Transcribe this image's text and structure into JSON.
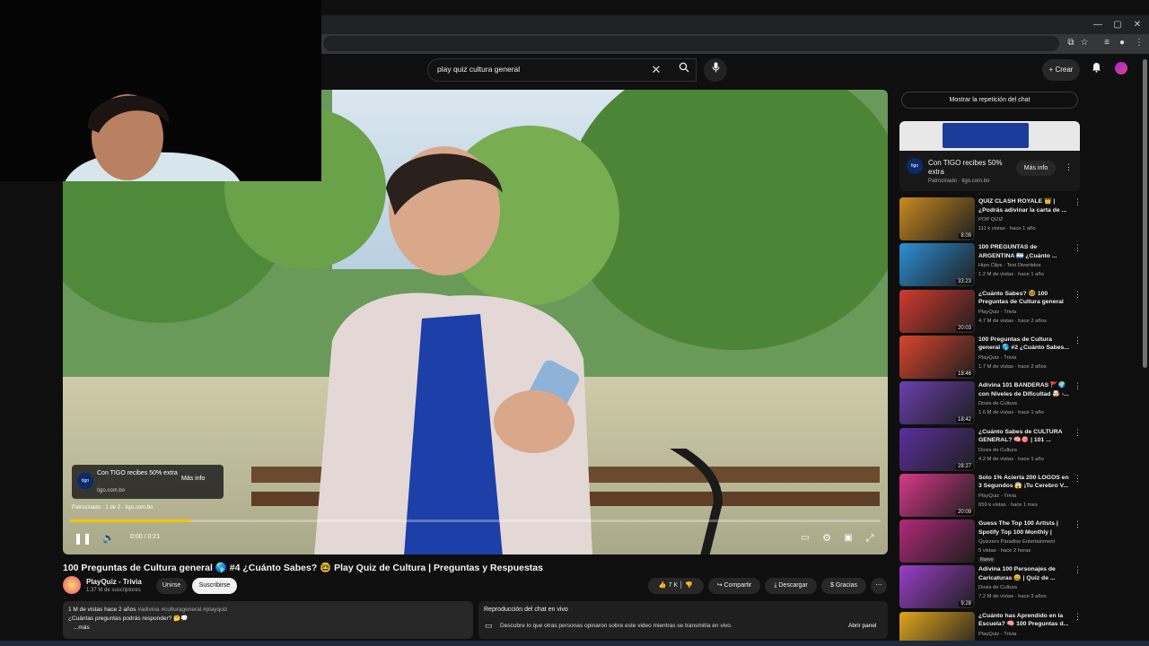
{
  "browser": {
    "minimize_icon": "minimize-icon",
    "maximize_icon": "maximize-icon",
    "close_icon": "close-icon"
  },
  "masthead": {
    "search_query": "play quiz cultura general",
    "clear_glyph": "✕",
    "create_label": "Crear"
  },
  "player": {
    "ad_title": "Con TIGO recibes 50% extra",
    "ad_domain": "tigo.com.bo",
    "ad_more_label": "Más info",
    "ad_logo_text": "tigo",
    "ad_status_line": "Patrocinado · 1 de 2 · tigo.com.bo",
    "time_display": "0:00 / 0:21",
    "progress_fraction": 0.15
  },
  "video": {
    "title": "100 Preguntas de Cultura general 🌎 #4 ¿Cuánto Sabes? 🤓 Play Quiz de Cultura | Preguntas y Respuestas",
    "channel_name": "PlayQuiz - Trivia",
    "subscribers": "1.37 M de suscriptores",
    "join_label": "Unirse",
    "subscribe_label": "Suscribirse",
    "likes": "7 K",
    "share_label": "Compartir",
    "download_label": "Descargar",
    "thanks_label": "Gracias",
    "views_age": "1 M de vistas  hace 2 años",
    "hashtags": "#adivina #culturageneral #playquiz",
    "desc_line": "¿Cuántas preguntas podrás responder? 🤔💭",
    "more_label": "...más"
  },
  "chat": {
    "header": "Reproducción del chat en vivo",
    "body": "Descubre lo que otras personas opinaron sobre este video mientras se transmitía en vivo.",
    "open_label": "Abrir panel",
    "replay_label": "Mostrar la repetición del chat"
  },
  "sponsor": {
    "title": "Con TIGO recibes 50% extra",
    "sponsored_line": "Patrocinado · tigo.com.bo",
    "more_label": "Más info",
    "logo_text": "tigo"
  },
  "recommendations": [
    {
      "title": "QUIZ CLASH ROYALE 👑 | ¿Podrás adivinar la carta de ...",
      "channel": "POP QUIZ",
      "meta": "111 k vistas · hace 1 año",
      "duration": "8:09",
      "color": "#c98a1f"
    },
    {
      "title": "100 PREGUNTAS de ARGENTINA 🇦🇷 ¿Cuánto ...",
      "channel": "Hipo Clips · Test Divertidos",
      "meta": "1.2 M de vistas · hace 1 año",
      "duration": "33:23",
      "color": "#2c8fd6"
    },
    {
      "title": "¿Cuánto Sabes? 🤓 100 Preguntas de Cultura general ...",
      "channel": "PlayQuiz - Trivia",
      "meta": "4.7 M de vistas · hace 2 años",
      "duration": "20:03",
      "color": "#d23a2e"
    },
    {
      "title": "100 Preguntas de Cultura general 🌎 #2 ¿Cuánto Sabes...",
      "channel": "PlayQuiz - Trivia",
      "meta": "1.7 M de vistas · hace 2 años",
      "duration": "18:46",
      "color": "#d9452f"
    },
    {
      "title": "Adivina 101 BANDERAS 🚩🌍 con Niveles de Dificultad 🤯 -...",
      "channel": "Dosis de Cultura",
      "meta": "1.6 M de vistas · hace 1 año",
      "duration": "18:42",
      "color": "#6a3fb0"
    },
    {
      "title": "¿Cuánto Sabes de CULTURA GENERAL? 🧠🎯 | 101 ...",
      "channel": "Dosis de Cultura",
      "meta": "4.2 M de vistas · hace 1 año",
      "duration": "28:27",
      "color": "#5b2f9e"
    },
    {
      "title": "Solo 1% Acierta 200 LOGOS en 3 Segundos 😱 ¡Tu Cerebro V...",
      "channel": "PlayQuiz - Trivia",
      "meta": "659 k vistas · hace 1 mes",
      "duration": "20:09",
      "color": "#d63a8a"
    },
    {
      "title": "Guess The Top 100 Artists | Spotify Top 100 Monthly | Mus...",
      "channel": "Quizzers Paradise Entertainment",
      "meta": "5 vistas · hace 2 horas",
      "duration": "",
      "badge": "Nuevo",
      "color": "#b2287a"
    },
    {
      "title": "Adivina 100 Personajes de Caricaturas 😄 | Quiz de ...",
      "channel": "Dosis de Cultura",
      "meta": "7.2 M de vistas · hace 3 años",
      "duration": "9:28",
      "color": "#9b3ec9"
    },
    {
      "title": "¿Cuánto has Aprendido en la Escuela? 🧠 100 Preguntas d...",
      "channel": "PlayQuiz - Trivia",
      "meta": "",
      "duration": "13:30",
      "color": "#e0a51e"
    }
  ]
}
